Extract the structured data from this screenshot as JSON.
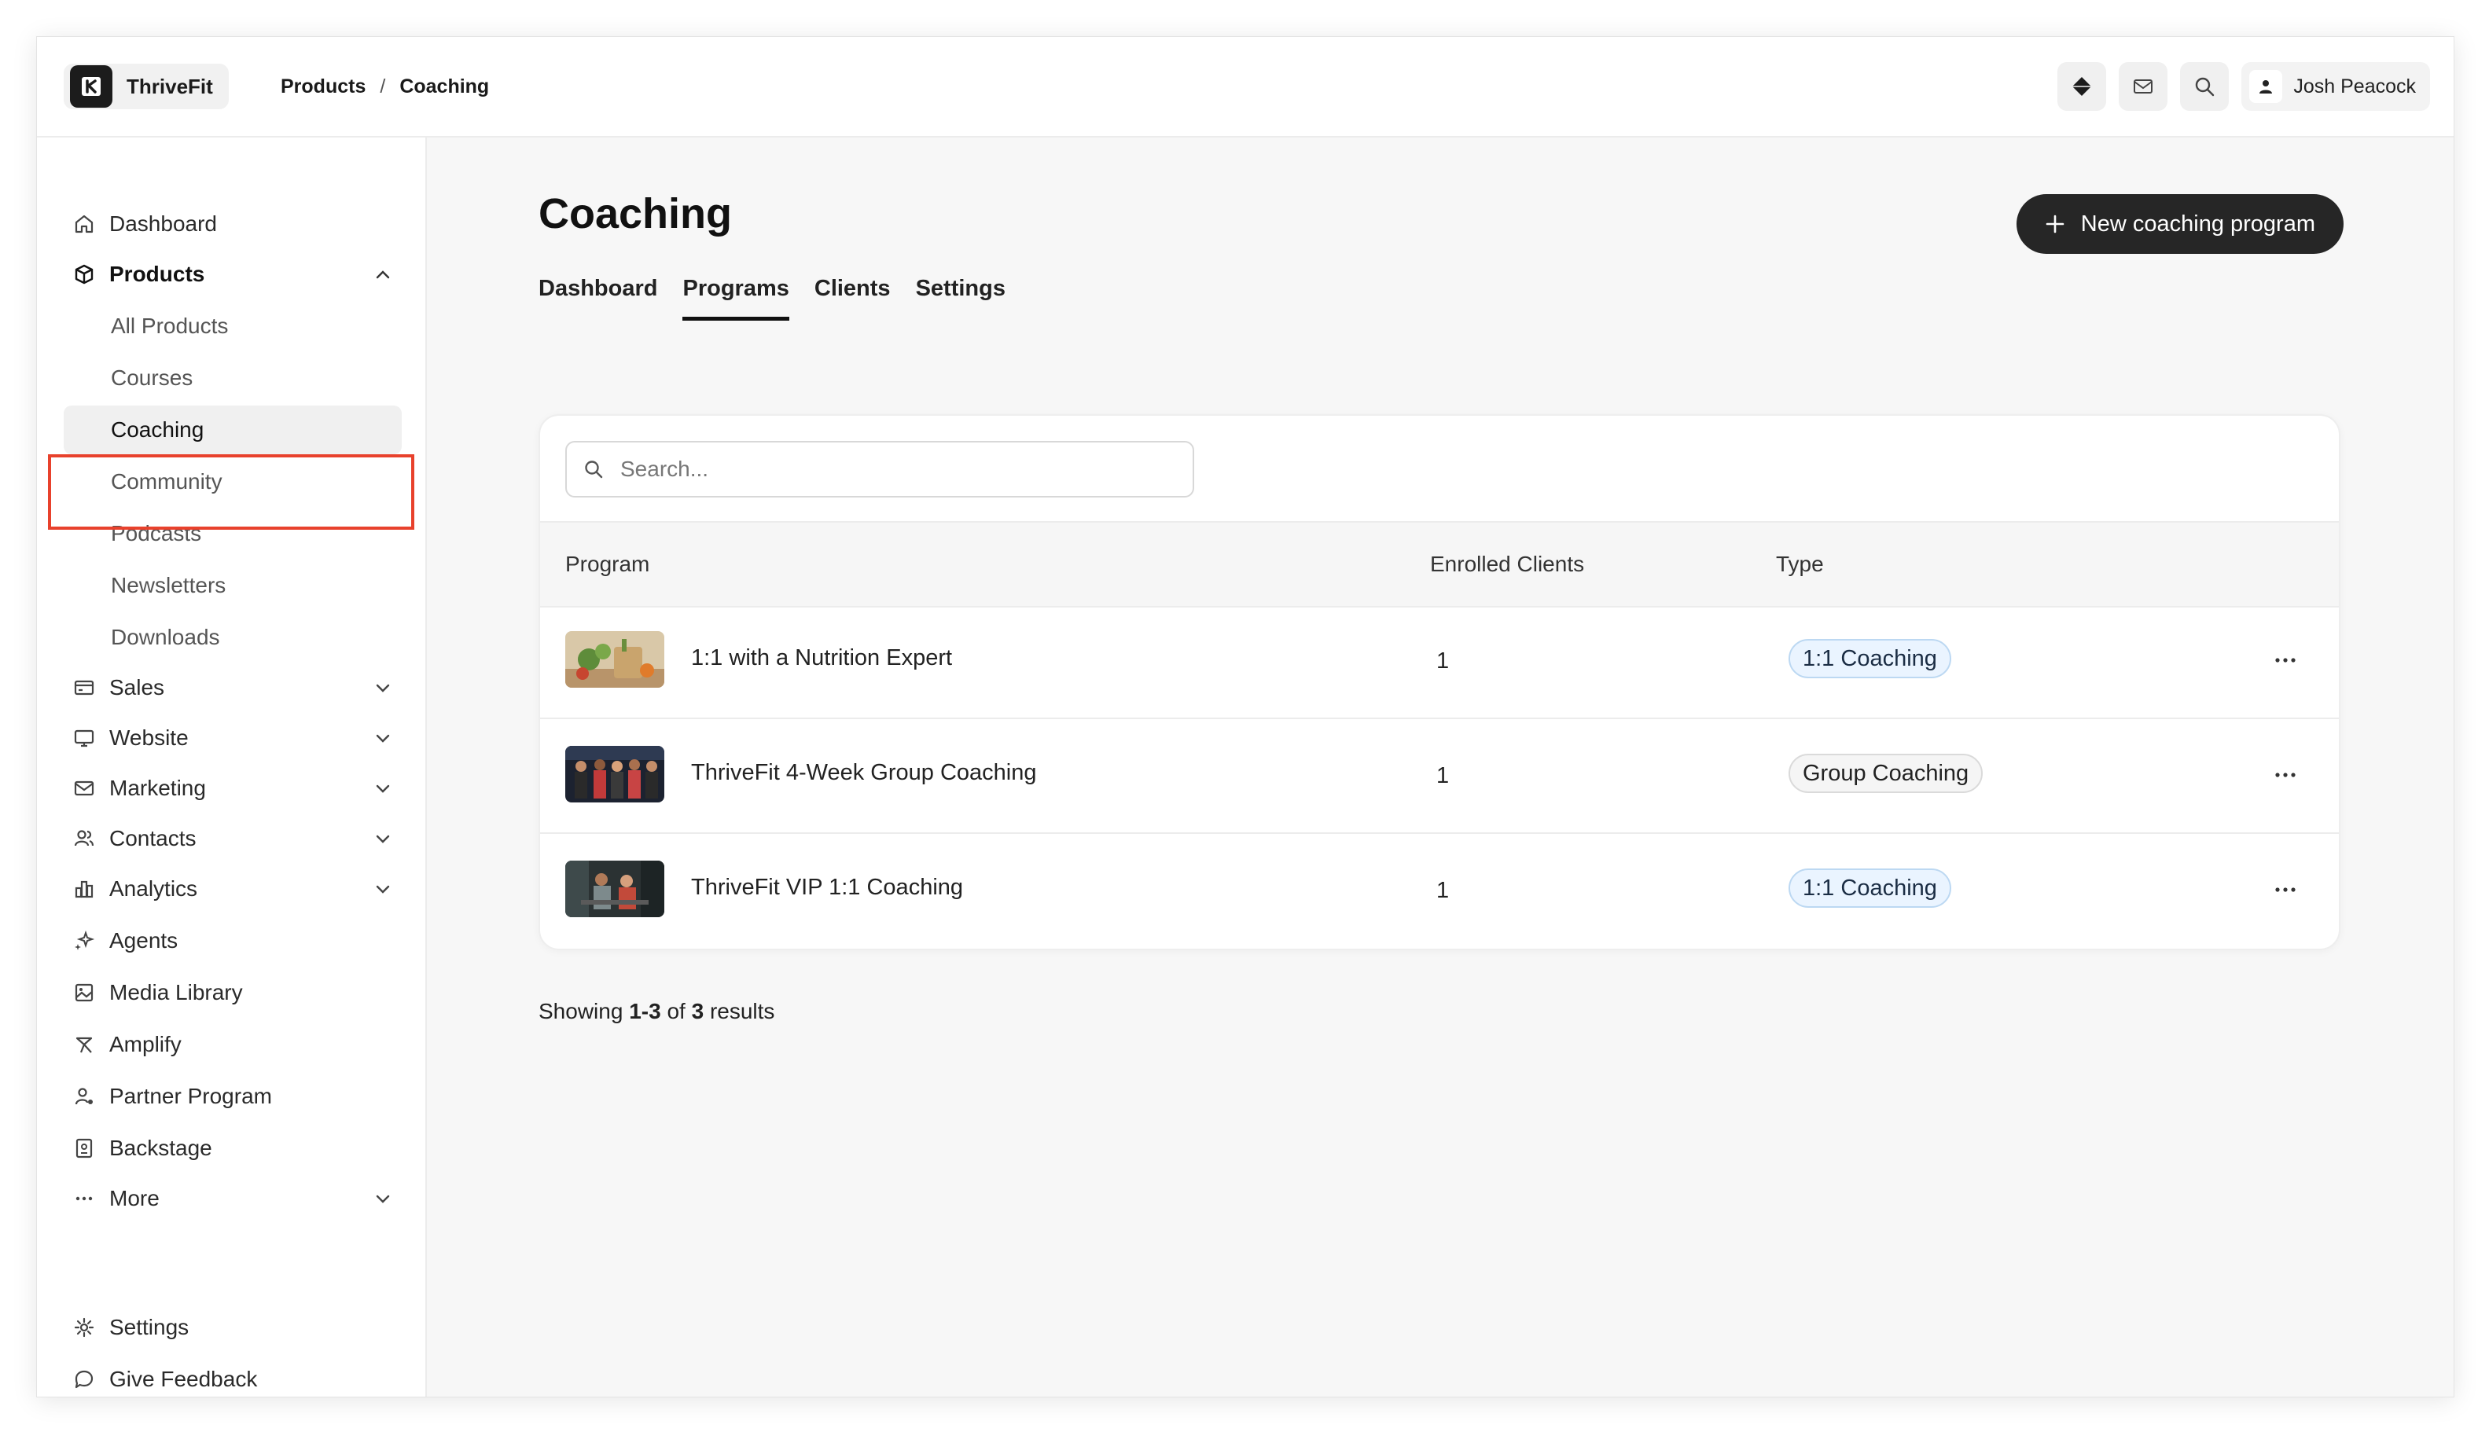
{
  "app": {
    "brand_name": "ThriveFit",
    "user_name": "Josh Peacock"
  },
  "breadcrumb": [
    "Products",
    "Coaching"
  ],
  "breadcrumb_sep": "/",
  "sidebar": {
    "items": [
      {
        "label": "Dashboard",
        "icon": "home-icon"
      },
      {
        "label": "Products",
        "icon": "box-icon",
        "expanded": true
      },
      {
        "label": "Sales",
        "icon": "credit-card-icon"
      },
      {
        "label": "Website",
        "icon": "monitor-icon"
      },
      {
        "label": "Marketing",
        "icon": "mail-icon"
      },
      {
        "label": "Contacts",
        "icon": "users-icon"
      },
      {
        "label": "Analytics",
        "icon": "bar-chart-icon"
      },
      {
        "label": "Agents",
        "icon": "sparkles-icon"
      },
      {
        "label": "Media Library",
        "icon": "image-icon"
      },
      {
        "label": "Amplify",
        "icon": "megaphone-icon"
      },
      {
        "label": "Partner Program",
        "icon": "partner-icon"
      },
      {
        "label": "Backstage",
        "icon": "badge-icon"
      },
      {
        "label": "More",
        "icon": "dots-icon"
      },
      {
        "label": "Settings",
        "icon": "gear-icon"
      },
      {
        "label": "Give Feedback",
        "icon": "chat-icon"
      }
    ],
    "products_sub": [
      "All Products",
      "Courses",
      "Coaching",
      "Community",
      "Podcasts",
      "Newsletters",
      "Downloads"
    ]
  },
  "main": {
    "title": "Coaching",
    "primary_button": "New coaching program",
    "tabs": [
      "Dashboard",
      "Programs",
      "Clients",
      "Settings"
    ],
    "active_tab": "Programs",
    "search_placeholder": "Search...",
    "columns": [
      "Program",
      "Enrolled Clients",
      "Type"
    ],
    "rows": [
      {
        "name": "1:1 with a Nutrition Expert",
        "enrolled": "1",
        "type": "1:1 Coaching"
      },
      {
        "name": "ThriveFit 4-Week Group Coaching",
        "enrolled": "1",
        "type": "Group Coaching"
      },
      {
        "name": "ThriveFit VIP 1:1 Coaching",
        "enrolled": "1",
        "type": "1:1 Coaching"
      }
    ],
    "results": {
      "prefix": "Showing",
      "range": "1-3",
      "of": "of",
      "total": "3",
      "suffix": "results"
    }
  },
  "colors": {
    "highlight": "#e8412c",
    "primary_button_bg": "#262626",
    "badge_blue_bg": "#eaf4ff"
  }
}
